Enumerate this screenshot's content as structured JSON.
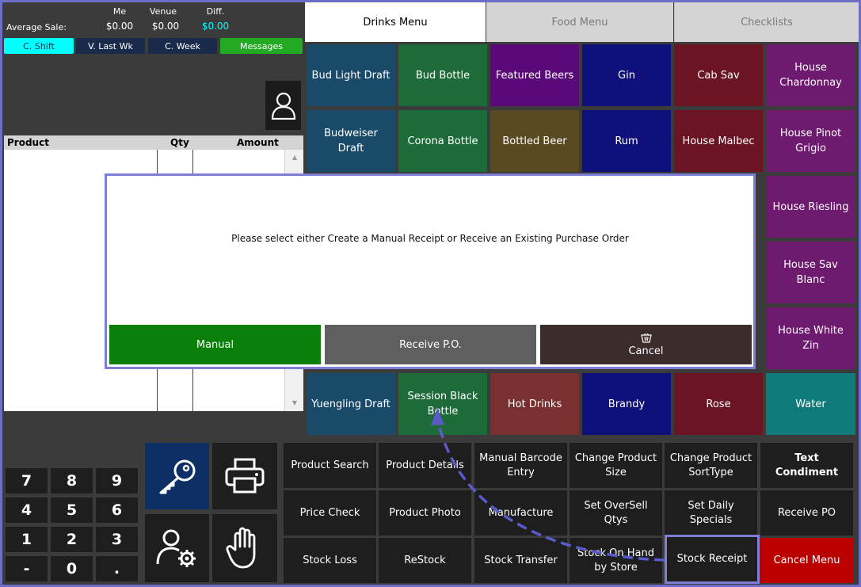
{
  "stats": {
    "avg_label": "Average Sale:",
    "col_me": "Me",
    "col_venue": "Venue",
    "col_diff": "Diff.",
    "me_value": "$0.00",
    "venue_value": "$0.00",
    "diff_value": "$0.00"
  },
  "quick_buttons": {
    "c_shift": "C. Shift",
    "v_last_wk": "V. Last Wk",
    "c_week": "C. Week",
    "messages": "Messages"
  },
  "table": {
    "col_product": "Product",
    "col_qty": "Qty",
    "col_amount": "Amount"
  },
  "tabs": {
    "drinks": "Drinks Menu",
    "food": "Food Menu",
    "checklists": "Checklists"
  },
  "menu": [
    {
      "label": "Bud Light Draft",
      "color": "#1a4a6a"
    },
    {
      "label": "Bud Bottle",
      "color": "#1e6b3a"
    },
    {
      "label": "Featured Beers",
      "color": "#5a0a78"
    },
    {
      "label": "Gin",
      "color": "#10107a"
    },
    {
      "label": "Cab Sav",
      "color": "#6a1424"
    },
    {
      "label": "House Chardonnay",
      "color": "#6e1a6e"
    },
    {
      "label": "Budweiser Draft",
      "color": "#1a4a6a"
    },
    {
      "label": "Corona Bottle",
      "color": "#1e6b3a"
    },
    {
      "label": "Bottled Beer",
      "color": "#5a4a22"
    },
    {
      "label": "Rum",
      "color": "#10107a"
    },
    {
      "label": "House Malbec",
      "color": "#6a1424"
    },
    {
      "label": "House Pinot Grigio",
      "color": "#6e1a6e"
    },
    {
      "label": "House Riesling",
      "color": "#6e1a6e"
    },
    {
      "label": "House Sav Blanc",
      "color": "#6e1a6e"
    },
    {
      "label": "House White Zin",
      "color": "#6e1a6e"
    },
    {
      "label": "Yuengling Draft",
      "color": "#1a4a6a"
    },
    {
      "label": "Session Black Bottle",
      "color": "#1e6b3a"
    },
    {
      "label": "Hot Drinks",
      "color": "#7a3030"
    },
    {
      "label": "Brandy",
      "color": "#10107a"
    },
    {
      "label": "Rose",
      "color": "#6a1424"
    },
    {
      "label": "Water",
      "color": "#107a7a"
    }
  ],
  "keypad": [
    "7",
    "8",
    "9",
    "4",
    "5",
    "6",
    "1",
    "2",
    "3",
    "-",
    "0",
    "."
  ],
  "functions": {
    "product_search": "Product Search",
    "product_details": "Product Details",
    "manual_barcode_entry": "Manual Barcode Entry",
    "change_product_size": "Change Product Size",
    "change_product_sorttype": "Change Product SortType",
    "text_condiment": "Text Condiment",
    "price_check": "Price Check",
    "product_photo": "Product Photo",
    "manufacture": "Manufacture",
    "set_oversell_qtys": "Set OverSell Qtys",
    "set_daily_specials": "Set Daily Specials",
    "receive_po": "Receive PO",
    "stock_loss": "Stock Loss",
    "restock": "ReStock",
    "stock_transfer": "Stock Transfer",
    "stock_on_hand_by_store": "Stock On Hand by Store",
    "stock_receipt": "Stock Receipt",
    "cancel_menu": "Cancel Menu"
  },
  "dialog": {
    "message": "Please select either Create a Manual Receipt or Receive an Existing Purchase Order",
    "manual": "Manual",
    "receive_po": "Receive P.O.",
    "cancel": "Cancel"
  },
  "colors": {
    "accent_cyan": "#00ffff",
    "messages_green": "#22aa22",
    "manual_green": "#0a800a",
    "cancel_menu_red": "#bb0000",
    "highlight_border": "#7e7ed6"
  },
  "icons": {
    "user": "user-icon",
    "key": "key-icon",
    "printer": "printer-icon",
    "user_settings": "user-settings-icon",
    "hand": "hand-icon",
    "cancel": "basket-icon"
  }
}
